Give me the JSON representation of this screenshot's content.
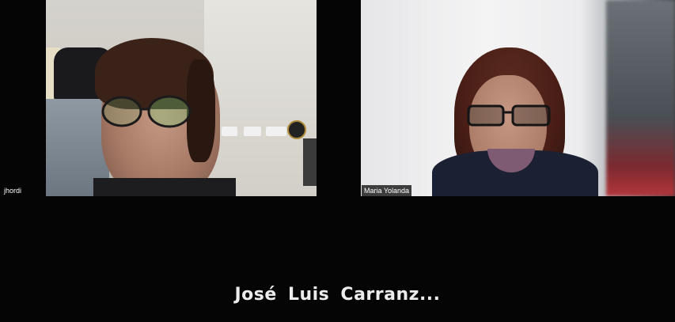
{
  "participants": [
    {
      "name": "jhordi"
    },
    {
      "name": "Maria Yolanda"
    }
  ],
  "active_speaker": {
    "name": "José Luis Carranz..."
  }
}
